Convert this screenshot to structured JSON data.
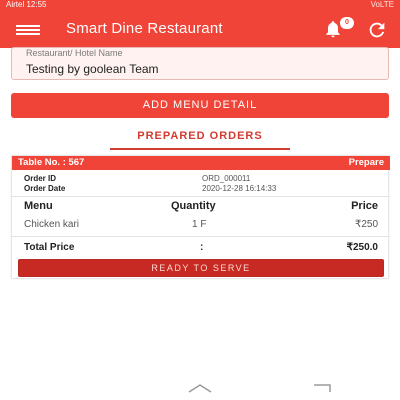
{
  "status_bar": {
    "left": "Airtel 12:55",
    "right": "VoLTE"
  },
  "app_bar": {
    "title": "Smart Dine Restaurant",
    "notification_count": "0"
  },
  "hotel": {
    "label": "Restaurant/ Hotel Name",
    "value": "Testing by goolean Team"
  },
  "actions": {
    "add_menu_label": "ADD MENU DETAIL",
    "ready_label": "READY TO SERVE"
  },
  "tabs": {
    "prepared_orders": "PREPARED ORDERS"
  },
  "order": {
    "table_label": "Table No. : 567",
    "status": "Prepare",
    "order_id_label": "Order ID",
    "order_id_value": "ORD_000011",
    "order_date_label": "Order Date",
    "order_date_value": "2020-12-28 16:14:33",
    "columns": {
      "menu": "Menu",
      "quantity": "Quantity",
      "price": "Price"
    },
    "items": [
      {
        "menu": "Chicken kari",
        "quantity": "1 F",
        "price": "₹250"
      }
    ],
    "total_label": "Total Price",
    "total_sep": ":",
    "total_value": "₹250.0"
  },
  "colors": {
    "accent": "#f04438",
    "dark_accent": "#c62a22"
  }
}
